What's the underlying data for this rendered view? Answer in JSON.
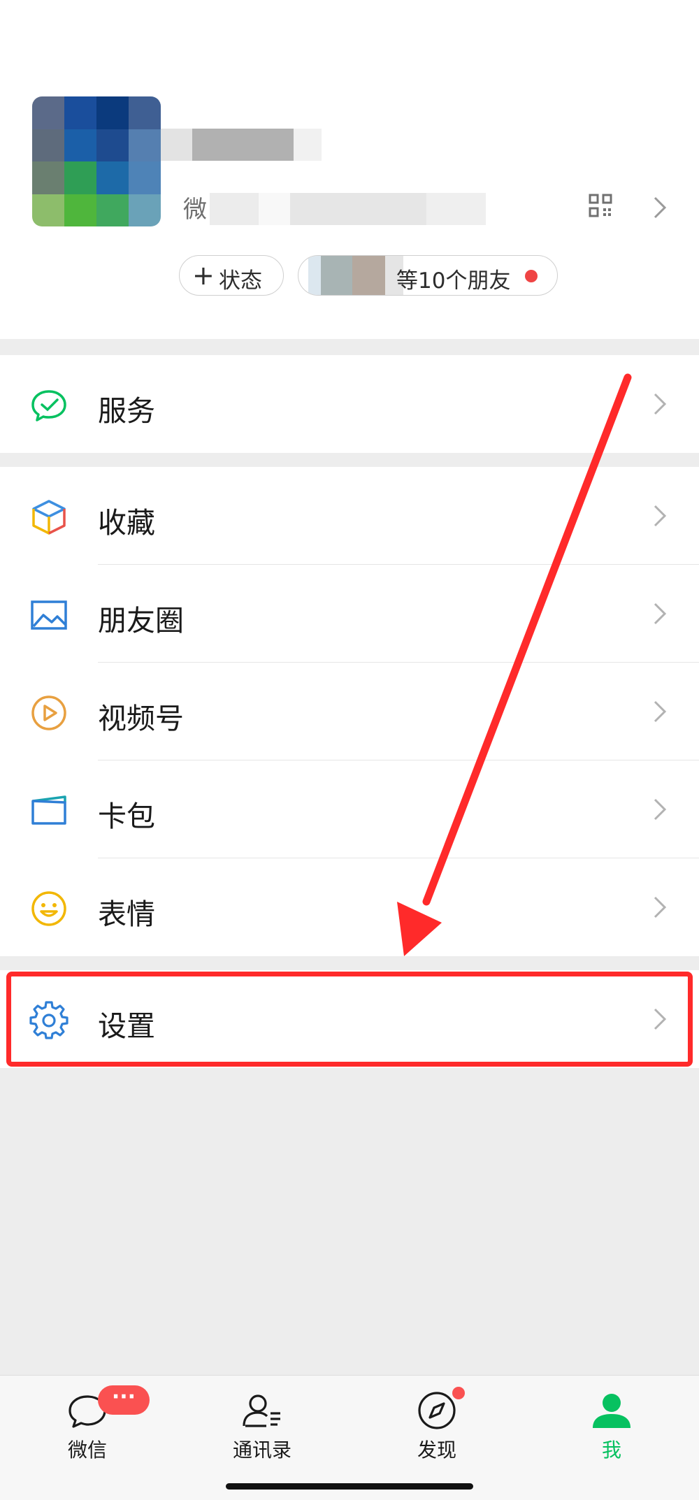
{
  "profile": {
    "wechat_id_prefix": "微",
    "status_button": {
      "icon": "plus-icon",
      "label": "状态"
    },
    "friends_status": {
      "label": "等10个朋友"
    },
    "avatar_colors": [
      "#5b6a89",
      "#1a4e9c",
      "#0b3a7d",
      "#3f5f93",
      "#5e6b7c",
      "#1b5fa8",
      "#1e4b8f",
      "#557fb0",
      "#6a7f70",
      "#2f9e55",
      "#1d6aa8",
      "#4e83b7",
      "#8dbd6b",
      "#4fb63c",
      "#40a85e",
      "#6aa2b8"
    ]
  },
  "menu": {
    "services": {
      "icon": "wechat-pay-icon",
      "label": "服务"
    },
    "group2": [
      {
        "icon": "cube-favorites-icon",
        "label": "收藏"
      },
      {
        "icon": "image-moments-icon",
        "label": "朋友圈"
      },
      {
        "icon": "play-channels-icon",
        "label": "视频号"
      },
      {
        "icon": "card-wallet-icon",
        "label": "卡包"
      },
      {
        "icon": "smile-sticker-icon",
        "label": "表情"
      }
    ],
    "settings": {
      "icon": "gear-icon",
      "label": "设置"
    }
  },
  "tabbar": {
    "tabs": [
      {
        "icon": "chat-bubble-icon",
        "label": "微信",
        "badge": "···"
      },
      {
        "icon": "contacts-icon",
        "label": "通讯录"
      },
      {
        "icon": "compass-icon",
        "label": "发现"
      },
      {
        "icon": "person-icon",
        "label": "我",
        "active": true
      }
    ]
  },
  "colors": {
    "accent": "#07c160",
    "badge": "#fa5151",
    "highlight": "#ff2a2a"
  }
}
